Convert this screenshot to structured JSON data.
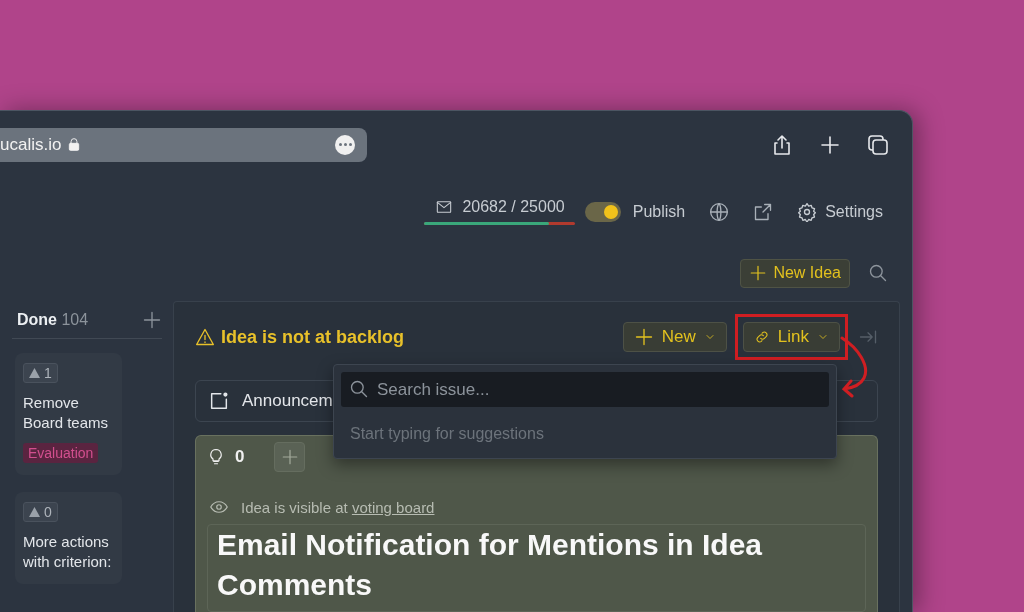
{
  "browser": {
    "address": "ucalis.io"
  },
  "header": {
    "email_quota": {
      "text": "20682 / 25000",
      "level": 0.83
    },
    "publish": {
      "label": "Publish",
      "on": true
    },
    "settings_label": "Settings"
  },
  "new_idea_button": "New Idea",
  "column": {
    "title": "Done",
    "count": "104",
    "cards": [
      {
        "votes": "1",
        "title": "Remove Board teams",
        "tag": "Evaluation"
      },
      {
        "votes": "0",
        "title": "More actions with criterion:"
      }
    ]
  },
  "detail": {
    "warning": "Idea is not at backlog",
    "buttons": [
      {
        "label": "New",
        "kind": "new",
        "highlighted": false
      },
      {
        "label": "Link",
        "kind": "link",
        "highlighted": true
      }
    ],
    "type_label": "Announcem",
    "vote_count": "0",
    "visibility": {
      "text": "Idea is visible at",
      "link": "voting board"
    },
    "title": "Email Notification for Mentions in Idea Comments"
  },
  "link_dropdown": {
    "placeholder": "Search issue...",
    "hint": "Start typing for suggestions"
  }
}
